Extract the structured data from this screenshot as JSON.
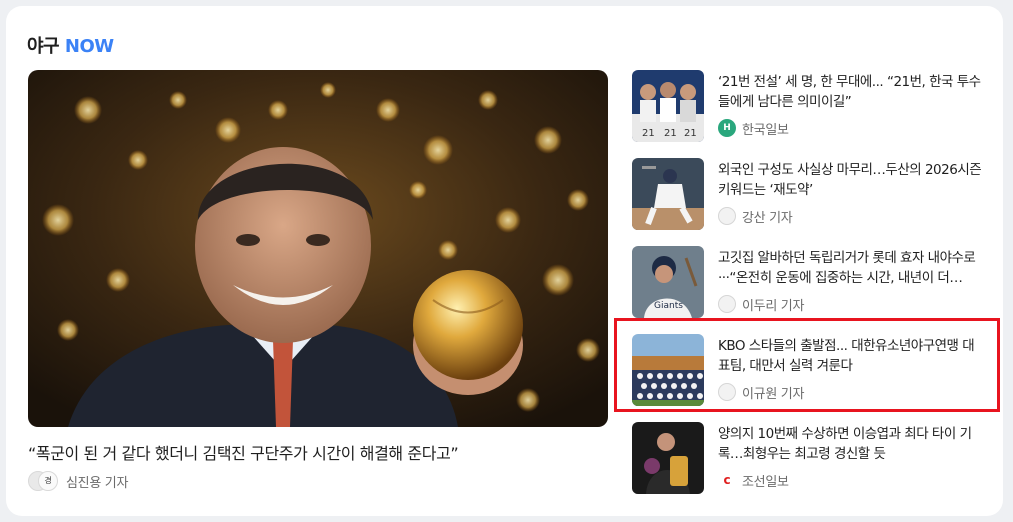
{
  "section": {
    "title_prefix": "야구",
    "title_accent": "NOW",
    "accent_color": "#3b82f6"
  },
  "featured": {
    "title": "“폭군이 된 거 같다 했더니 김택진 구단주가 시간이 해결해 준다고”",
    "reporter": "심진용 기자",
    "image": "portrait-holding-golden-ball"
  },
  "news": [
    {
      "title": "‘21번 전설’ 세 명, 한 무대에... “21번, 한국 투수들에게 남다른 의미이길”",
      "source": "한국일보",
      "logo": "H",
      "logo_style": "green"
    },
    {
      "title": "외국인 구성도 사실상 마무리…두산의 2026시즌 키워드는 ‘재도약’",
      "source": "강산 기자",
      "logo": "",
      "logo_style": "grey"
    },
    {
      "title": "고깃집 알바하던 독립리거가 롯데 효자 내야수로···“온전히 운동에 집중하는 시간, 내년이 더…",
      "source": "이두리 기자",
      "logo": "",
      "logo_style": "grey"
    },
    {
      "title": "KBO 스타들의 출발점... 대한유소년야구연맹 대표팀, 대만서 실력 겨룬다",
      "source": "이규원 기자",
      "logo": "",
      "logo_style": "grey"
    },
    {
      "title": "양의지 10번째 수상하면 이승엽과 최다 타이 기록…최형우는 최고령 경신할 듯",
      "source": "조선일보",
      "logo": "c",
      "logo_style": "red"
    }
  ],
  "highlight_color": "#e8141f"
}
